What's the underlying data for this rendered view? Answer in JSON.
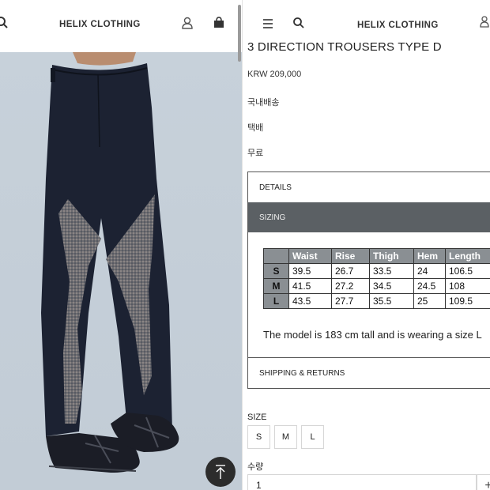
{
  "left_panel": {
    "brand": "HELIX CLOTHING",
    "icons": [
      "search-icon",
      "user-icon",
      "shopping-bag-icon",
      "arrow-up-icon"
    ]
  },
  "right_panel": {
    "brand": "HELIX CLOTHING",
    "icons": [
      "menu-icon",
      "search-icon",
      "user-icon"
    ],
    "product": {
      "title": "3 DIRECTION TROUSERS TYPE D",
      "price": "KRW 209,000",
      "shipping_region": "국내배송",
      "shipping_method": "택배",
      "shipping_fee": "무료"
    },
    "accordion": {
      "details_label": "DETAILS",
      "sizing_label": "SIZING",
      "shipping_label": "SHIPPING & RETURNS",
      "sizing_table": {
        "headers": [
          "",
          "Waist",
          "Rise",
          "Thigh",
          "Hem",
          "Length"
        ],
        "rows": [
          [
            "S",
            "39.5",
            "26.7",
            "33.5",
            "24",
            "106.5"
          ],
          [
            "M",
            "41.5",
            "27.2",
            "34.5",
            "24.5",
            "108"
          ],
          [
            "L",
            "43.5",
            "27.7",
            "35.5",
            "25",
            "109.5"
          ]
        ]
      },
      "model_note": "The model is 183 cm tall and is wearing a size L"
    },
    "options": {
      "size_label": "SIZE",
      "sizes": [
        "S",
        "M",
        "L"
      ],
      "quantity_label": "수량",
      "quantity_value": "1",
      "plus_label": "+"
    }
  },
  "colors": {
    "accordion_active": "#5b6064",
    "table_header": "#8a8f93",
    "trouser_main": "#1b2131",
    "trouser_panel": "#6c6c70",
    "background_photo": "#c9d3dd"
  }
}
